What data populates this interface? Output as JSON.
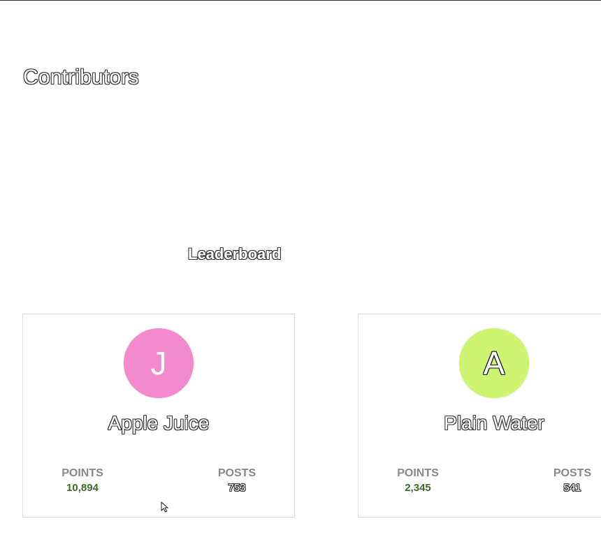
{
  "page": {
    "title": "Contributors"
  },
  "section": {
    "title": "Leaderboard"
  },
  "cards": [
    {
      "initial": "J",
      "name": "Apple Juice",
      "avatar_color": "#f38acb",
      "points_label": "POINTS",
      "points": "10,894",
      "posts_label": "POSTS",
      "posts": "753"
    },
    {
      "initial": "A",
      "name": "Plain Water",
      "avatar_color": "#cdf571",
      "points_label": "POINTS",
      "points": "2,345",
      "posts_label": "POSTS",
      "posts": "541"
    }
  ],
  "colors": {
    "points_value": "#3d6b2a",
    "stat_label": "#888888",
    "card_border": "#dddddd"
  },
  "icons": {
    "pointer": "mouse-cursor-icon"
  }
}
